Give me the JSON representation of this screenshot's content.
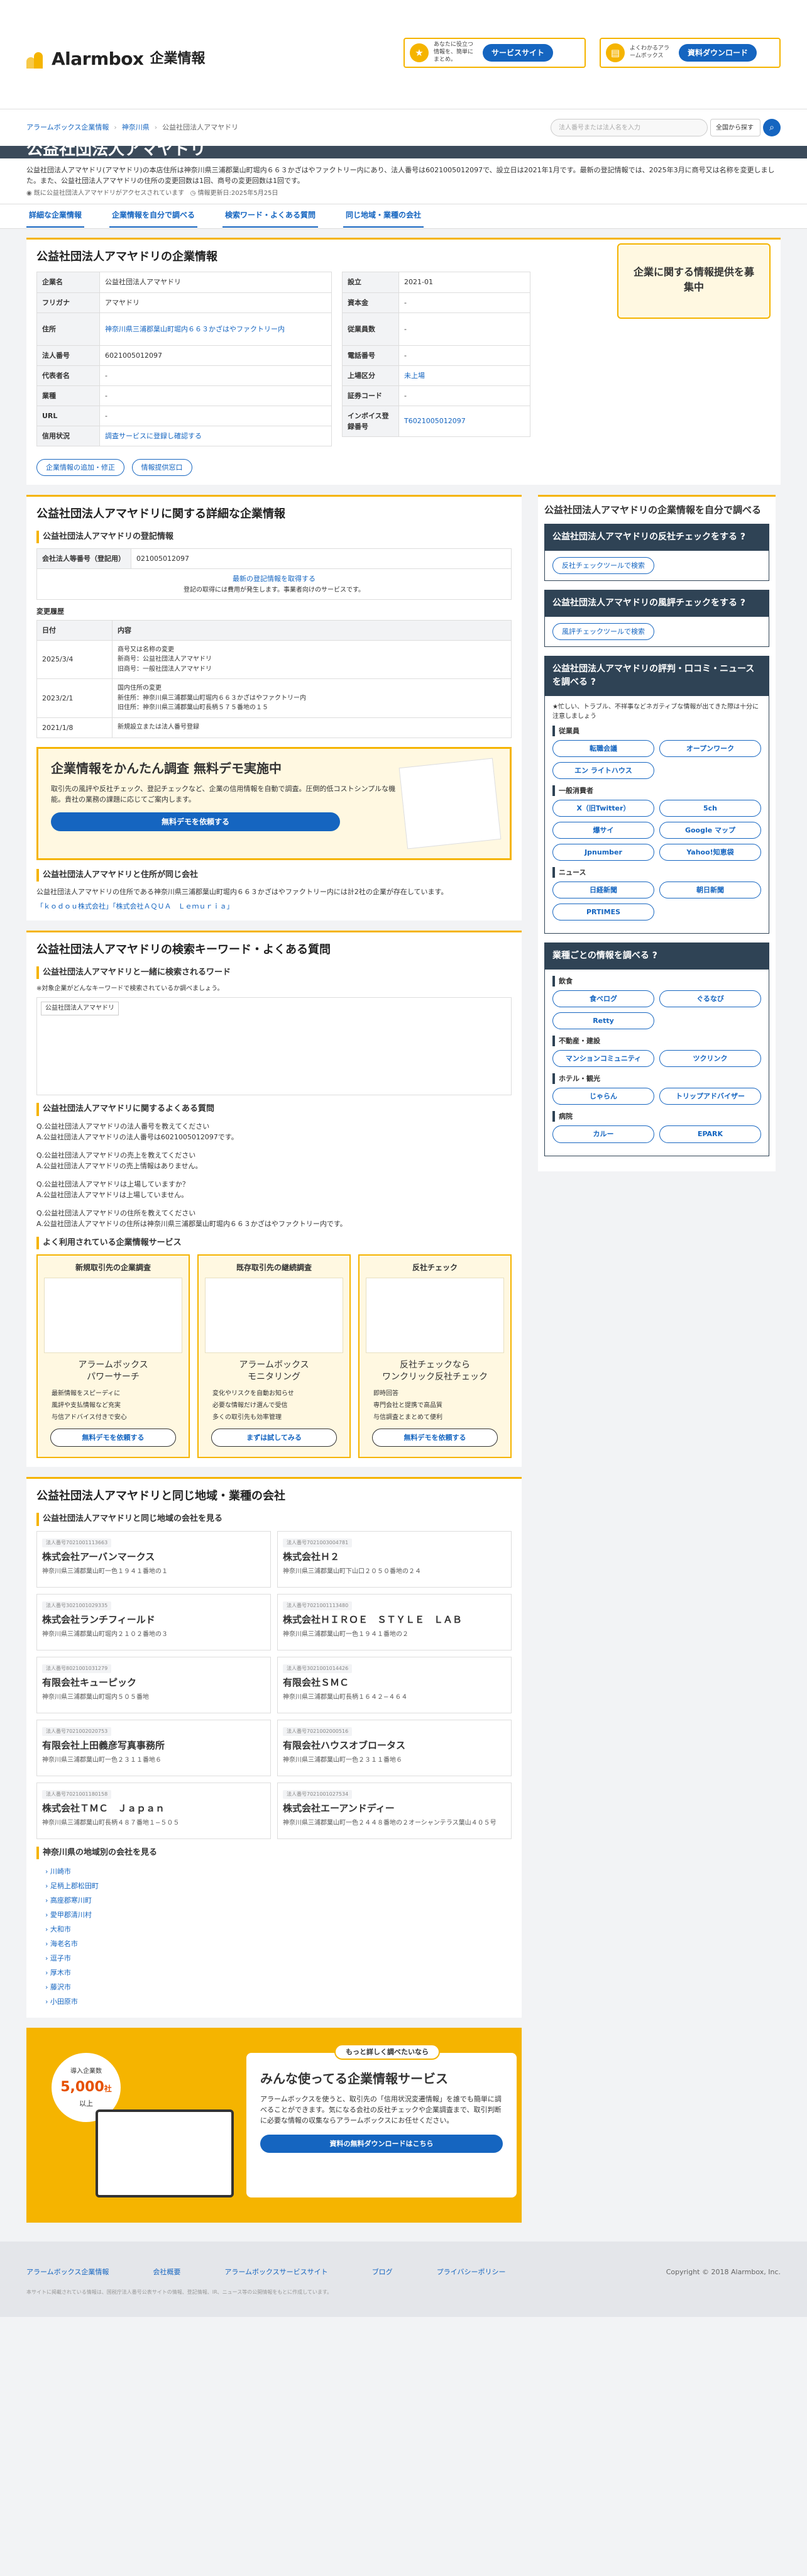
{
  "header": {
    "brand": "Alarmbox",
    "brand_sub": "企業情報",
    "btn1_note": "あなたに役立つ情報を、簡単にまとめ。",
    "btn1_label": "サービスサイト",
    "btn2_note": "よくわかるアラームボックス",
    "btn2_label": "資料ダウンロード"
  },
  "breadcrumb": [
    "アラームボックス企業情報",
    "神奈川県",
    "公益社団法人アマヤドリ"
  ],
  "search": {
    "placeholder": "法人番号または法人名を入力",
    "scope": "全国から探す"
  },
  "page": {
    "title": "公益社団法人アマヤドリ",
    "intro": "公益社団法人アマヤドリ(アマヤドリ)の本店住所は神奈川県三浦郡葉山町堀内６６３かざはやファクトリー内にあり、法人番号は6021005012097で、設立日は2021年1月です。最新の登記情報では、2025年3月に商号又は名称を変更しました。また、公益社団法人アマヤドリの住所の変更回数は1回、商号の変更回数は1回です。",
    "meta_status": "既に公益社団法人アマヤドリがアクセスされています",
    "meta_update": "情報更新日:2025年5月25日"
  },
  "nav": [
    "詳細な企業情報",
    "企業情報を自分で調べる",
    "検索ワード・よくある質問",
    "同じ地域・業種の会社"
  ],
  "overview": {
    "heading": "公益社団法人アマヤドリの企業情報",
    "left": [
      {
        "k": "企業名",
        "v": "公益社団法人アマヤドリ"
      },
      {
        "k": "フリガナ",
        "v": "アマヤドリ"
      },
      {
        "k": "住所",
        "v": "神奈川県三浦郡葉山町堀内６６３かざはやファクトリー内"
      },
      {
        "k": "法人番号",
        "v": "6021005012097"
      },
      {
        "k": "代表者名",
        "v": "-"
      },
      {
        "k": "業種",
        "v": "-"
      },
      {
        "k": "URL",
        "v": "-"
      },
      {
        "k": "信用状況",
        "v": "調査サービスに登録し確認する"
      }
    ],
    "right": [
      {
        "k": "設立",
        "v": "2021-01"
      },
      {
        "k": "資本金",
        "v": "-"
      },
      {
        "k": "従業員数",
        "v": "-"
      },
      {
        "k": "電話番号",
        "v": "-"
      },
      {
        "k": "上場区分",
        "v": "未上場"
      },
      {
        "k": "証券コード",
        "v": "-"
      },
      {
        "k": "インボイス登録番号",
        "v": "T6021005012097"
      }
    ],
    "btn_add": "企業情報の追加・修正",
    "btn_provide": "情報提供窓口",
    "ad_small": "企業に関する情報提供を募集中"
  },
  "detail": {
    "heading": "公益社団法人アマヤドリに関する詳細な企業情報",
    "reg_heading": "公益社団法人アマヤドリの登記情報",
    "reg_k": "会社法人等番号（登記用）",
    "reg_v": "021005012097",
    "reg_link": "最新の登記情報を取得する",
    "reg_note": "登記の取得には費用が発生します。事業者向けのサービスです。",
    "hist_title": "変更履歴",
    "hist_cols": [
      "日付",
      "内容"
    ],
    "hist": [
      {
        "d": "2025/3/4",
        "c": "商号又は名称の変更\n新商号：公益社団法人アマヤドリ\n旧商号：一般社団法人アマヤドリ"
      },
      {
        "d": "2023/2/1",
        "c": "国内住所の変更\n新住所：神奈川県三浦郡葉山町堀内６６３かざはやファクトリー内\n旧住所：神奈川県三浦郡葉山町長柄５７５番地の１５"
      },
      {
        "d": "2021/1/8",
        "c": "新規設立または法人番号登録"
      }
    ],
    "promo_title": "企業情報をかんたん調査 無料デモ実施中",
    "promo_text": "取引先の風評や反社チェック、登記チェックなど、企業の信用情報を自動で調査。圧倒的低コストシンプルな機能。貴社の業務の課題に応じてご案内します。",
    "promo_cta": "無料デモを依頼する",
    "same_heading": "公益社団法人アマヤドリと住所が同じ会社",
    "same_text": "公益社団法人アマヤドリの住所である神奈川県三浦郡葉山町堀内６６３かざはやファクトリー内には計2社の企業が存在しています。",
    "same_links": "「ｋｏｄｏｕ株式会社」「株式会社ＡＱＵＡ　Ｌｅｍｕｒｉａ」"
  },
  "keywords": {
    "heading": "公益社団法人アマヤドリの検索キーワード・よくある質問",
    "sub": "公益社団法人アマヤドリと一緒に検索されるワード",
    "note": "※対象企業がどんなキーワードで検索されているか調べましょう。",
    "word": "公益社団法人アマヤドリ",
    "faq_heading": "公益社団法人アマヤドリに関するよくある質問",
    "faq": [
      {
        "q": "Q.公益社団法人アマヤドリの法人番号を教えてください",
        "a": "A.公益社団法人アマヤドリの法人番号は6021005012097です。"
      },
      {
        "q": "Q.公益社団法人アマヤドリの売上を教えてください",
        "a": "A.公益社団法人アマヤドリの売上情報はありません。"
      },
      {
        "q": "Q.公益社団法人アマヤドリは上場していますか？",
        "a": "A.公益社団法人アマヤドリは上場していません。"
      },
      {
        "q": "Q.公益社団法人アマヤドリの住所を教えてください",
        "a": "A.公益社団法人アマヤドリの住所は神奈川県三浦郡葉山町堀内６６３かざはやファクトリー内です。"
      }
    ],
    "svc_heading": "よく利用されている企業情報サービス",
    "svc": [
      {
        "t": "新規取引先の企業調査",
        "n": "アラームボックス\nパワーサーチ",
        "f": [
          "最新情報をスピーディに",
          "風評や支払情報など充実",
          "与信アドバイス付きで安心"
        ],
        "b": "無料デモを依頼する"
      },
      {
        "t": "既存取引先の継続調査",
        "n": "アラームボックス\nモニタリング",
        "f": [
          "変化やリスクを自動お知らせ",
          "必要な情報だけ選んで受信",
          "多くの取引先も効率管理"
        ],
        "b": "まずは試してみる"
      },
      {
        "t": "反社チェック",
        "n": "反社チェックなら\nワンクリック反社チェック",
        "f": [
          "即時回答",
          "専門会社と提携で高品質",
          "与信調査とまとめて便利"
        ],
        "b": "無料デモを依頼する"
      }
    ]
  },
  "region": {
    "heading": "公益社団法人アマヤドリと同じ地域・業種の会社",
    "sub": "公益社団法人アマヤドリと同じ地域の会社を見る",
    "companies": [
      {
        "tag": "法人番号7021001113663",
        "n": "株式会社アーバンマークス",
        "a": "神奈川県三浦郡葉山町一色１９４１番地の１"
      },
      {
        "tag": "法人番号7021003004781",
        "n": "株式会社Ｈ２",
        "a": "神奈川県三浦郡葉山町下山口２０５０番地の２４"
      },
      {
        "tag": "法人番号3021001029335",
        "n": "株式会社ランチフィールド",
        "a": "神奈川県三浦郡葉山町堀内２１０２番地の３"
      },
      {
        "tag": "法人番号7021001113480",
        "n": "株式会社ＨＩＲＯＥ　ＳＴＹＬＥ　ＬＡＢ",
        "a": "神奈川県三浦郡葉山町一色１９４１番地の２"
      },
      {
        "tag": "法人番号8021001031279",
        "n": "有限会社キューピック",
        "a": "神奈川県三浦郡葉山町堀内５０５番地"
      },
      {
        "tag": "法人番号3021001014426",
        "n": "有限会社ＳＭＣ",
        "a": "神奈川県三浦郡葉山町長柄１６４２−４６４"
      },
      {
        "tag": "法人番号7021002020753",
        "n": "有限会社上田義彦写真事務所",
        "a": "神奈川県三浦郡葉山町一色２３１１番地６"
      },
      {
        "tag": "法人番号7021002000516",
        "n": "有限会社ハウスオブロータス",
        "a": "神奈川県三浦郡葉山町一色２３１１番地６"
      },
      {
        "tag": "法人番号7021001180158",
        "n": "株式会社ＴＭＣ　Ｊａｐａｎ",
        "a": "神奈川県三浦郡葉山町長柄４８７番地１−５０５"
      },
      {
        "tag": "法人番号7021001027534",
        "n": "株式会社エーアンドディー",
        "a": "神奈川県三浦郡葉山町一色２４４８番地の２オーシャンテラス葉山４０５号"
      }
    ],
    "cities_heading": "神奈川県の地域別の会社を見る",
    "cities": [
      "川崎市",
      "足柄上郡松田町",
      "高座郡寒川町",
      "愛甲郡清川村",
      "大和市",
      "海老名市",
      "逗子市",
      "厚木市",
      "藤沢市",
      "小田原市"
    ]
  },
  "side": {
    "heading": "公益社団法人アマヤドリの企業情報を自分で調べる",
    "anti_heading": "公益社団法人アマヤドリの反社チェックをする",
    "anti_btn": "反社チェックツールで検索",
    "rep_heading": "公益社団法人アマヤドリの風評チェックをする",
    "rep_btn": "風評チェックツールで検索",
    "rev_heading": "公益社団法人アマヤドリの評判・口コミ・ニュースを調べる",
    "rev_note": "★忙しい、トラブル、不祥事などネガティブな情報が出てきた際は十分に注意しましょう",
    "g1": "従業員",
    "g1_items": [
      "転職会議",
      "オープンワーク",
      "エン ライトハウス"
    ],
    "g2": "一般消費者",
    "g2_items": [
      "X（旧Twitter）",
      "5ch",
      "爆サイ",
      "Google マップ",
      "Jpnumber",
      "Yahoo!知恵袋"
    ],
    "g3": "ニュース",
    "g3_items": [
      "日経新聞",
      "朝日新聞",
      "PRTIMES"
    ],
    "ind_heading": "業種ごとの情報を調べる",
    "i1": "飲食",
    "i1_items": [
      "食べログ",
      "ぐるなび",
      "Retty"
    ],
    "i2": "不動産・建設",
    "i2_items": [
      "マンションコミュニティ",
      "ツクリンク"
    ],
    "i3": "ホテル・観光",
    "i3_items": [
      "じゃらん",
      "トリップアドバイザー"
    ],
    "i4": "病院",
    "i4_items": [
      "カルー",
      "EPARK"
    ]
  },
  "bigpromo": {
    "badge": "導入企業数",
    "count": "5,000",
    "unit": "社",
    "plus": "以上",
    "top": "もっと詳しく調べたいなら",
    "title": "みんな使ってる企業情報サービス",
    "text": "アラームボックスを使うと、取引先の「信用状況変遷情報」を誰でも簡単に調べることができます。気になる会社の反社チェックや企業調査まで、取引判断に必要な情報の収集ならアラームボックスにお任せください。",
    "cta": "資料の無料ダウンロードはこちら"
  },
  "footer": {
    "links": [
      "アラームボックス企業情報",
      "会社概要",
      "アラームボックスサービスサイト",
      "ブログ",
      "プライバシーポリシー"
    ],
    "copy": "Copyright © 2018 Alarmbox, Inc.",
    "note": "本サイトに掲載されている情報は、国税庁法人番号公表サイトの情報、登記情報、IR、ニュース等の公開情報をもとに作成しています。"
  },
  "colors": {
    "accent": "#f5b400",
    "link": "#1565c0",
    "dark": "#2f4355"
  }
}
